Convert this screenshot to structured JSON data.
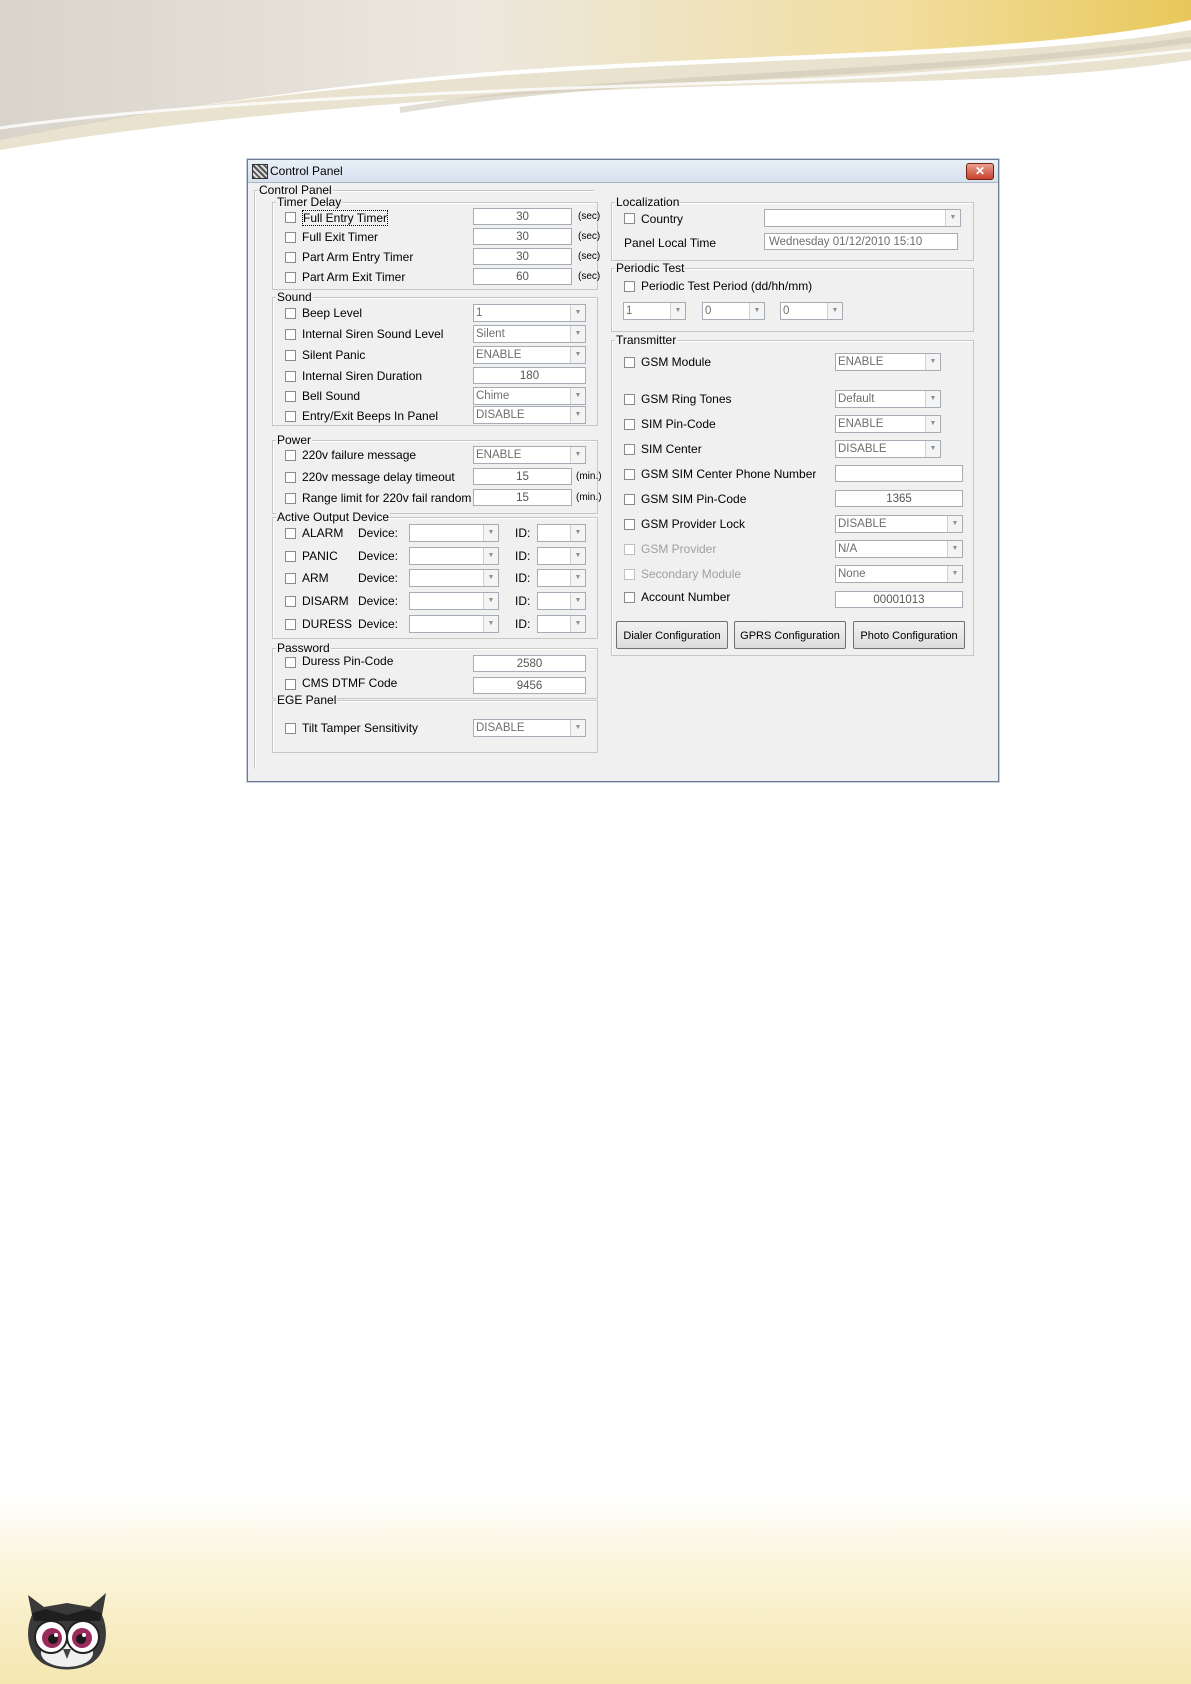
{
  "colors": {
    "accent": "#e8c85a",
    "cream": "#f7ecc0",
    "dialog_bg": "#f0f0f0",
    "close_red": "#c8402c"
  },
  "window": {
    "title": "Control Panel",
    "close_icon": "close-icon"
  },
  "main_group": {
    "label": "Control Panel"
  },
  "timer_delay": {
    "label": "Timer Delay",
    "rows": [
      {
        "label": "Full Entry Timer",
        "value": "30",
        "unit": "(sec)"
      },
      {
        "label": "Full Exit Timer",
        "value": "30",
        "unit": "(sec)"
      },
      {
        "label": "Part Arm Entry Timer",
        "value": "30",
        "unit": "(sec)"
      },
      {
        "label": "Part Arm Exit Timer",
        "value": "60",
        "unit": "(sec)"
      }
    ]
  },
  "sound": {
    "label": "Sound",
    "rows": [
      {
        "label": "Beep Level",
        "value": "1"
      },
      {
        "label": "Internal Siren Sound Level",
        "value": "Silent"
      },
      {
        "label": "Silent Panic",
        "value": "ENABLE"
      },
      {
        "label": "Internal Siren Duration",
        "value": "180"
      },
      {
        "label": "Bell Sound",
        "value": "Chime"
      },
      {
        "label": "Entry/Exit Beeps In Panel",
        "value": "DISABLE"
      }
    ]
  },
  "power": {
    "label": "Power",
    "rows": [
      {
        "label": "220v failure message",
        "value": "ENABLE"
      },
      {
        "label": "220v message delay timeout",
        "value": "15",
        "unit": "(min.)"
      },
      {
        "label": "Range limit for 220v fail random",
        "value": "15",
        "unit": "(min.)"
      }
    ]
  },
  "active_output": {
    "label": "Active Output Device",
    "device_label": "Device:",
    "id_label": "ID:",
    "rows": [
      {
        "label": "ALARM"
      },
      {
        "label": "PANIC"
      },
      {
        "label": "ARM"
      },
      {
        "label": "DISARM"
      },
      {
        "label": "DURESS"
      }
    ]
  },
  "password": {
    "label": "Password",
    "rows": [
      {
        "label": "Duress Pin-Code",
        "value": "2580"
      },
      {
        "label": "CMS DTMF Code",
        "value": "9456"
      }
    ]
  },
  "ege_panel": {
    "label": "EGE Panel",
    "tilt": {
      "label": "Tilt Tamper Sensitivity",
      "value": "DISABLE"
    }
  },
  "localization": {
    "label": "Localization",
    "country": {
      "label": "Country",
      "value": ""
    },
    "local_time": {
      "label": "Panel Local Time",
      "value": "Wednesday 01/12/2010 15:10"
    }
  },
  "periodic_test": {
    "label": "Periodic Test",
    "period_label": "Periodic Test Period (dd/hh/mm)",
    "dd": "1",
    "hh": "0",
    "mm": "0"
  },
  "transmitter": {
    "label": "Transmitter",
    "rows": [
      {
        "label": "GSM Module",
        "value": "ENABLE"
      },
      {
        "label": "GSM Ring Tones",
        "value": "Default"
      },
      {
        "label": "SIM Pin-Code",
        "value": "ENABLE"
      },
      {
        "label": "SIM Center",
        "value": "DISABLE"
      },
      {
        "label": "GSM SIM Center Phone Number",
        "value": ""
      },
      {
        "label": "GSM SIM Pin-Code",
        "value": "1365"
      },
      {
        "label": "GSM Provider Lock",
        "value": "DISABLE"
      },
      {
        "label": "GSM Provider",
        "value": "N/A"
      },
      {
        "label": "Secondary Module",
        "value": "None"
      },
      {
        "label": "Account Number",
        "value": "00001013"
      }
    ],
    "buttons": {
      "dialer": "Dialer Configuration",
      "gprs": "GPRS Configuration",
      "photo": "Photo Configuration"
    }
  }
}
